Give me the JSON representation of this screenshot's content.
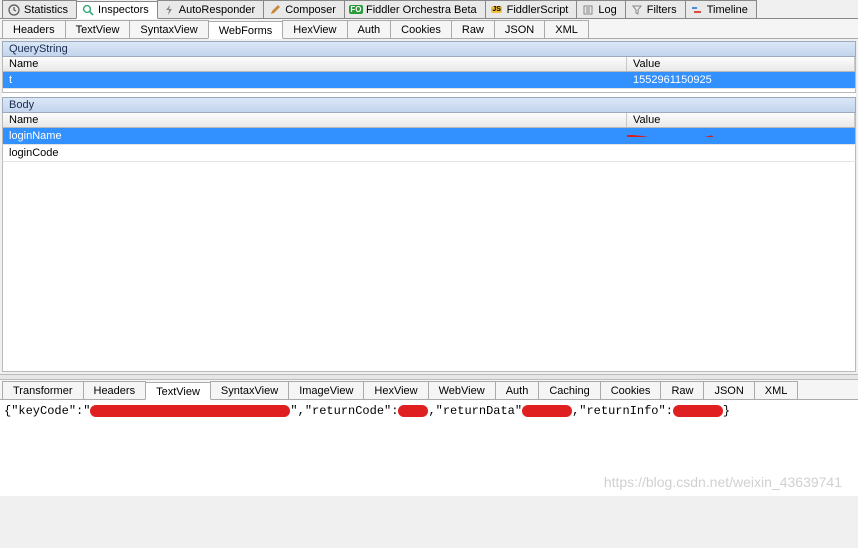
{
  "mainTabs": [
    {
      "label": "Statistics",
      "icon": "clock-icon"
    },
    {
      "label": "Inspectors",
      "icon": "magnifier-icon",
      "active": true
    },
    {
      "label": "AutoResponder",
      "icon": "bolt-icon"
    },
    {
      "label": "Composer",
      "icon": "pencil-icon"
    },
    {
      "label": "Fiddler Orchestra Beta",
      "icon": "fo-icon"
    },
    {
      "label": "FiddlerScript",
      "icon": "script-icon"
    },
    {
      "label": "Log",
      "icon": "log-icon"
    },
    {
      "label": "Filters",
      "icon": "filter-icon"
    },
    {
      "label": "Timeline",
      "icon": "timeline-icon"
    }
  ],
  "requestTabs": [
    "Headers",
    "TextView",
    "SyntaxView",
    "WebForms",
    "HexView",
    "Auth",
    "Cookies",
    "Raw",
    "JSON",
    "XML"
  ],
  "requestActiveTab": "WebForms",
  "queryString": {
    "title": "QueryString",
    "headers": {
      "name": "Name",
      "value": "Value"
    },
    "rows": [
      {
        "name": "t",
        "value": "1552961150925",
        "selected": true
      }
    ]
  },
  "body": {
    "title": "Body",
    "headers": {
      "name": "Name",
      "value": "Value"
    },
    "rows": [
      {
        "name": "loginName",
        "value": "",
        "selected": true,
        "redacted": true
      },
      {
        "name": "loginCode",
        "value": "",
        "selected": false,
        "redacted": true
      }
    ]
  },
  "responseTabs": [
    "Transformer",
    "Headers",
    "TextView",
    "SyntaxView",
    "ImageView",
    "HexView",
    "WebView",
    "Auth",
    "Caching",
    "Cookies",
    "Raw",
    "JSON",
    "XML"
  ],
  "responseActiveTab": "TextView",
  "responseText": {
    "open": "{",
    "k1": "\"keyCode\":\"",
    "sep1": "\",\"returnCode\":",
    "sep2": ",\"returnData\"",
    "sep3": ",\"returnInfo\":",
    "close": "}"
  },
  "watermark": "https://blog.csdn.net/weixin_43639741"
}
